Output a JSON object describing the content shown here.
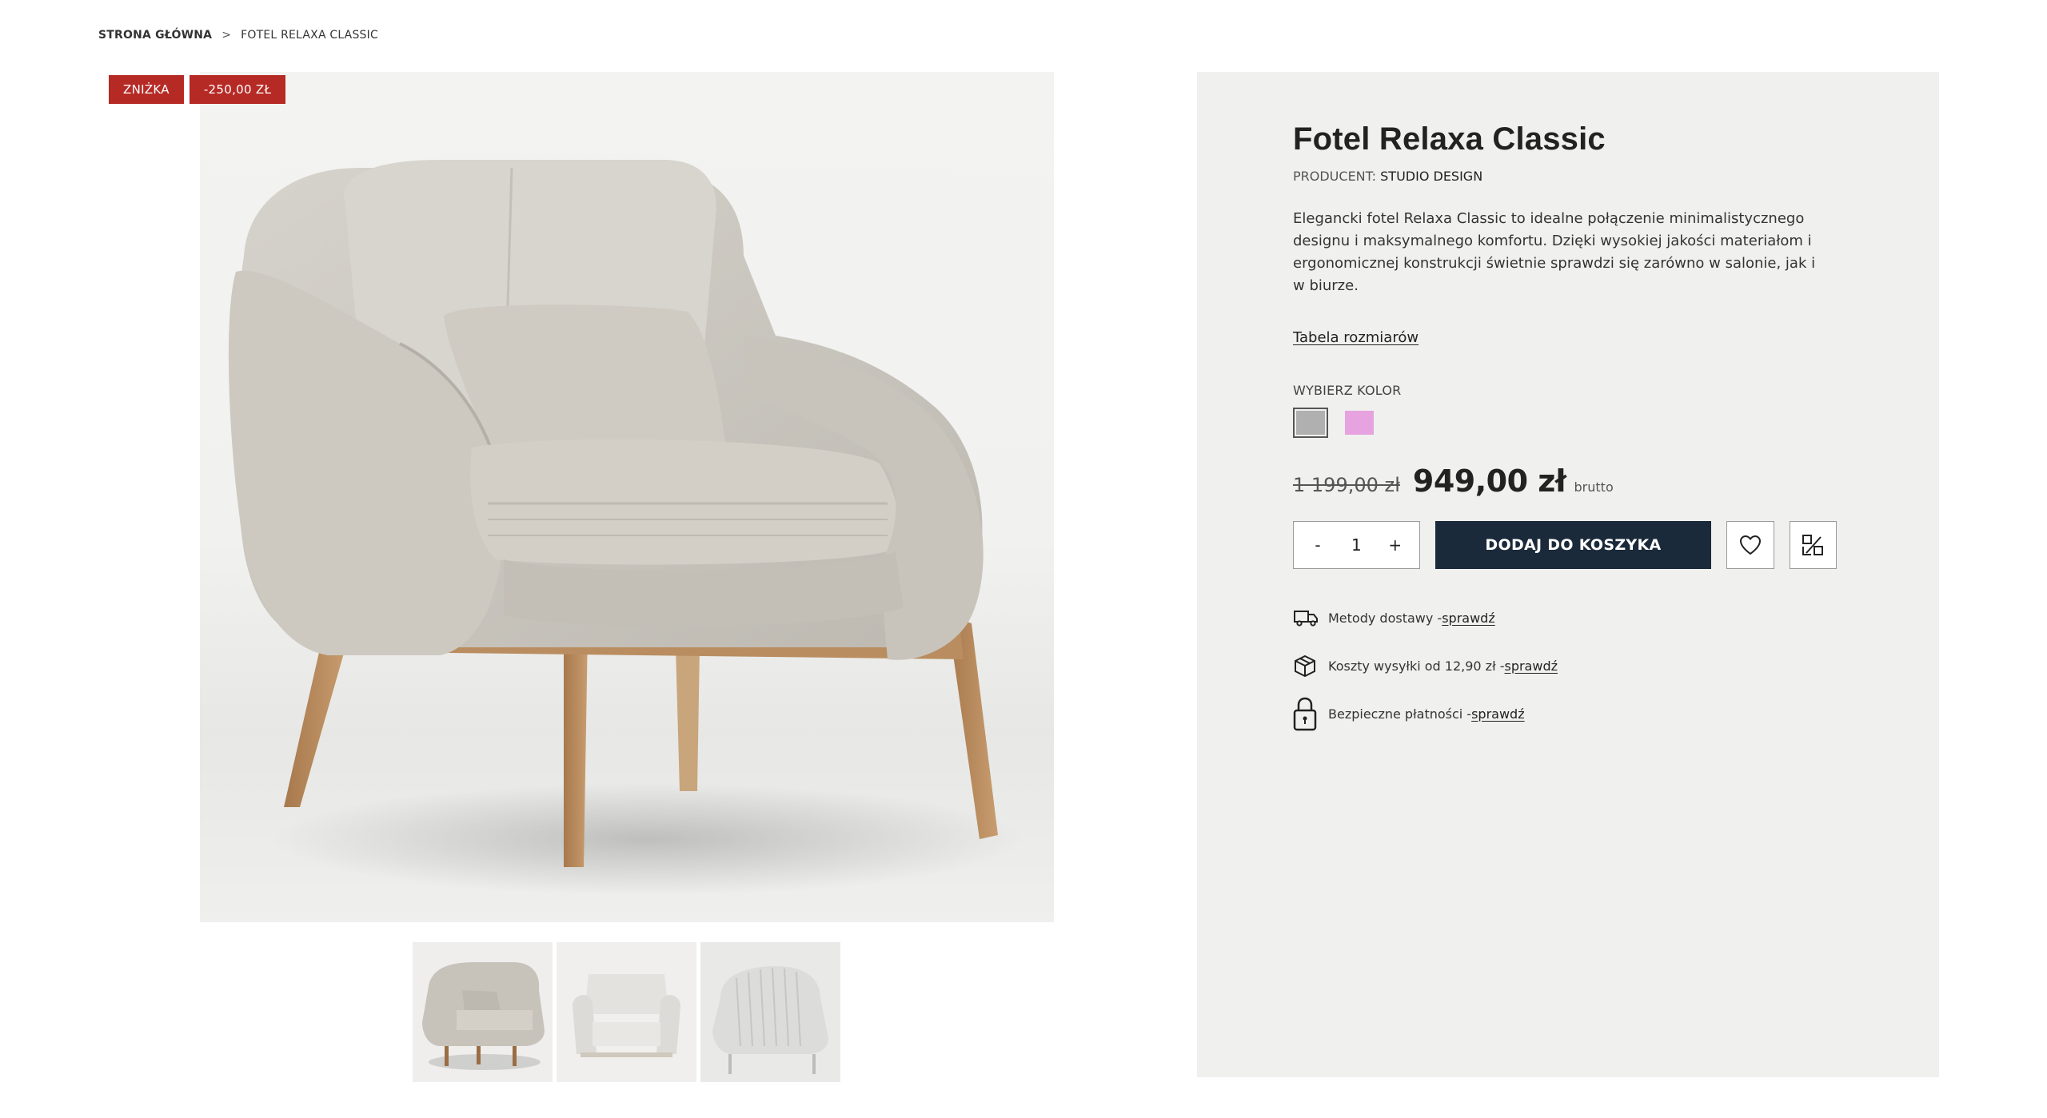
{
  "breadcrumb": {
    "home": "STRONA GŁÓWNA",
    "separator": ">",
    "current": "FOTEL RELAXA CLASSIC"
  },
  "badges": {
    "sale": "ZNIŻKA",
    "discount": "-250,00 ZŁ"
  },
  "colors": {
    "badge": "#b62a25",
    "primary_button": "#1b2a3a",
    "panel": "#f0f0ee"
  },
  "product": {
    "title": "Fotel Relaxa Classic",
    "producer_label": "PRODUCENT:",
    "producer_name": "STUDIO DESIGN",
    "description": "Elegancki fotel Relaxa Classic to idealne połączenie minimalistycznego designu i maksymalnego komfortu. Dzięki wysokiej jakości materiałom i ergonomicznej konstrukcji świetnie sprawdzi się zarówno w salonie, jak i w biurze.",
    "size_table_link": "Tabela rozmiarów",
    "color_label": "WYBIERZ KOLOR",
    "color_options": [
      {
        "name": "grey",
        "hex": "#b0b0b0",
        "selected": true
      },
      {
        "name": "pink",
        "hex": "#e7a3e0",
        "selected": false
      }
    ],
    "old_price": "1 199,00 zł",
    "price": "949,00 zł",
    "price_note": "brutto",
    "quantity": {
      "minus": "-",
      "value": "1",
      "plus": "+"
    },
    "add_to_cart": "DODAJ DO KOSZYKA",
    "icons": {
      "wishlist": "heart-icon",
      "compare": "compare-icon"
    }
  },
  "info": {
    "delivery_text": "Metody dostawy - ",
    "delivery_link": "sprawdź",
    "shipping_text": "Koszty wysyłki od 12,90 zł - ",
    "shipping_link": "sprawdź",
    "payment_text": "Bezpieczne płatności - ",
    "payment_link": "sprawdź"
  },
  "gallery": {
    "thumbnail_count": 3
  }
}
